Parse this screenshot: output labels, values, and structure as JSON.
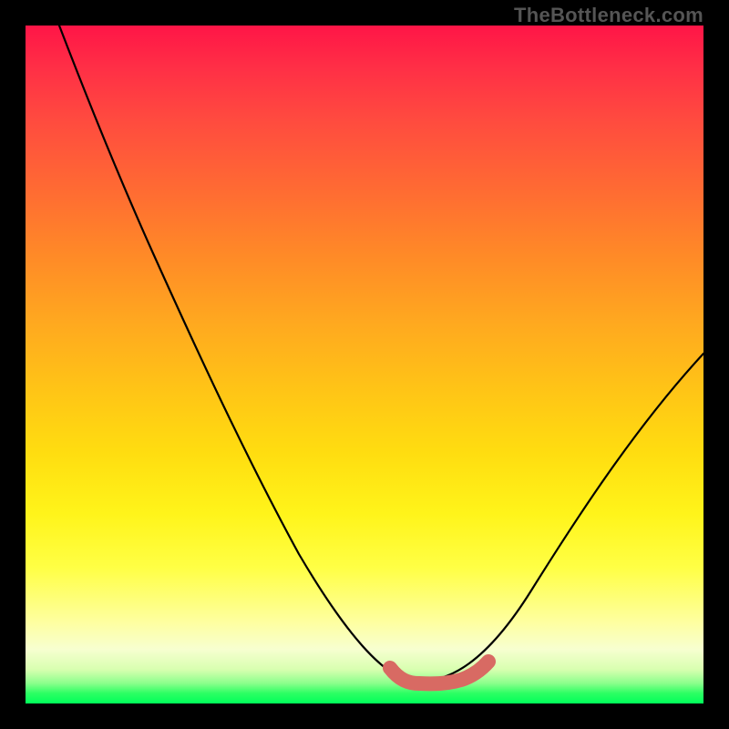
{
  "watermark": {
    "text": "TheBottleneck.com"
  },
  "chart_data": {
    "type": "line",
    "title": "",
    "xlabel": "",
    "ylabel": "",
    "xlim": [
      0,
      100
    ],
    "ylim": [
      0,
      100
    ],
    "series": [
      {
        "name": "main-curve",
        "x": [
          5,
          10,
          15,
          20,
          25,
          30,
          35,
          40,
          45,
          50,
          54,
          57,
          60,
          63,
          66,
          70,
          75,
          80,
          85,
          90,
          95,
          100
        ],
        "values": [
          100,
          92,
          84,
          75,
          66,
          57,
          48,
          39,
          30,
          21,
          12,
          6,
          3,
          3,
          4,
          7,
          13,
          20,
          28,
          36,
          44,
          52
        ]
      },
      {
        "name": "bottom-segment",
        "x": [
          56,
          58,
          60,
          62,
          64,
          66,
          68
        ],
        "values": [
          6,
          4,
          3,
          3,
          3.5,
          4.5,
          6
        ]
      }
    ],
    "annotations": [],
    "grid": false,
    "legend": false
  }
}
